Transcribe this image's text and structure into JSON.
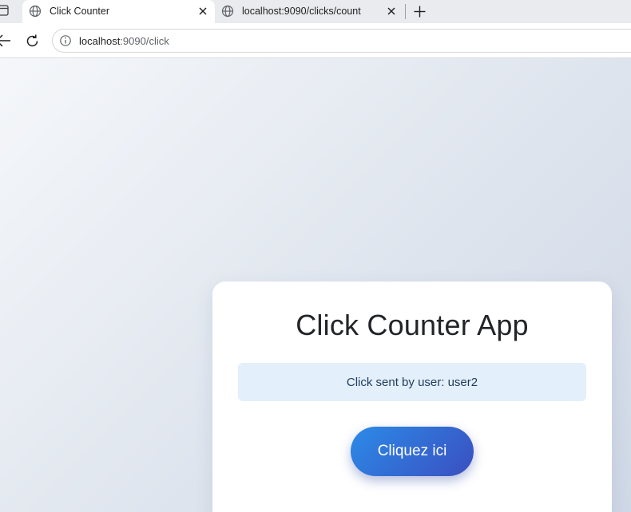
{
  "browser": {
    "tabs": [
      {
        "title": "Click Counter",
        "active": true
      },
      {
        "title": "localhost:9090/clicks/count",
        "active": false
      }
    ],
    "address_bar": {
      "host": "localhost",
      "path": ":9090/click"
    }
  },
  "app": {
    "title": "Click Counter App",
    "message": "Click sent by user: user2",
    "button_label": "Cliquez ici"
  },
  "colors": {
    "button_gradient_start": "#2b8be8",
    "button_gradient_end": "#3b4fc0",
    "message_background": "#e3f0fb"
  }
}
